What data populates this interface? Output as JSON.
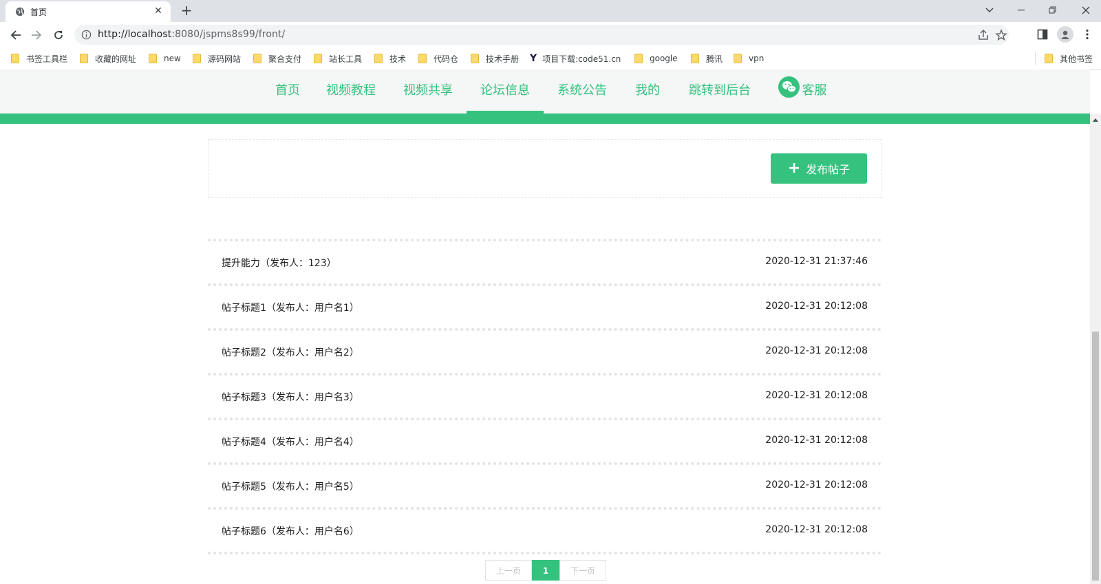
{
  "browser": {
    "tab_title": "首页",
    "url_host": "http://localhost",
    "url_rest": ":8080/jspms8s99/front/",
    "bookmarks": [
      "书签工具栏",
      "收藏的网址",
      "new",
      "源码网站",
      "聚合支付",
      "站长工具",
      "技术",
      "代码仓",
      "技术手册",
      "项目下载:code51.cn",
      "google",
      "腾讯",
      "vpn"
    ],
    "other_bookmarks": "其他书签"
  },
  "nav": {
    "items": [
      "首页",
      "视频教程",
      "视频共享",
      "论坛信息",
      "系统公告",
      "我的",
      "跳转到后台"
    ],
    "active": "论坛信息",
    "service": "客服"
  },
  "publish_button": "发布帖子",
  "posts": [
    {
      "title": "提升能力（发布人：123）",
      "time": "2020-12-31 21:37:46"
    },
    {
      "title": "帖子标题1（发布人：用户名1）",
      "time": "2020-12-31 20:12:08"
    },
    {
      "title": "帖子标题2（发布人：用户名2）",
      "time": "2020-12-31 20:12:08"
    },
    {
      "title": "帖子标题3（发布人：用户名3）",
      "time": "2020-12-31 20:12:08"
    },
    {
      "title": "帖子标题4（发布人：用户名4）",
      "time": "2020-12-31 20:12:08"
    },
    {
      "title": "帖子标题5（发布人：用户名5）",
      "time": "2020-12-31 20:12:08"
    },
    {
      "title": "帖子标题6（发布人：用户名6）",
      "time": "2020-12-31 20:12:08"
    }
  ],
  "pagination": {
    "prev": "上一页",
    "current": "1",
    "next": "下一页"
  },
  "colors": {
    "accent": "#34c27e",
    "nav_bg": "#f5f6f6"
  }
}
